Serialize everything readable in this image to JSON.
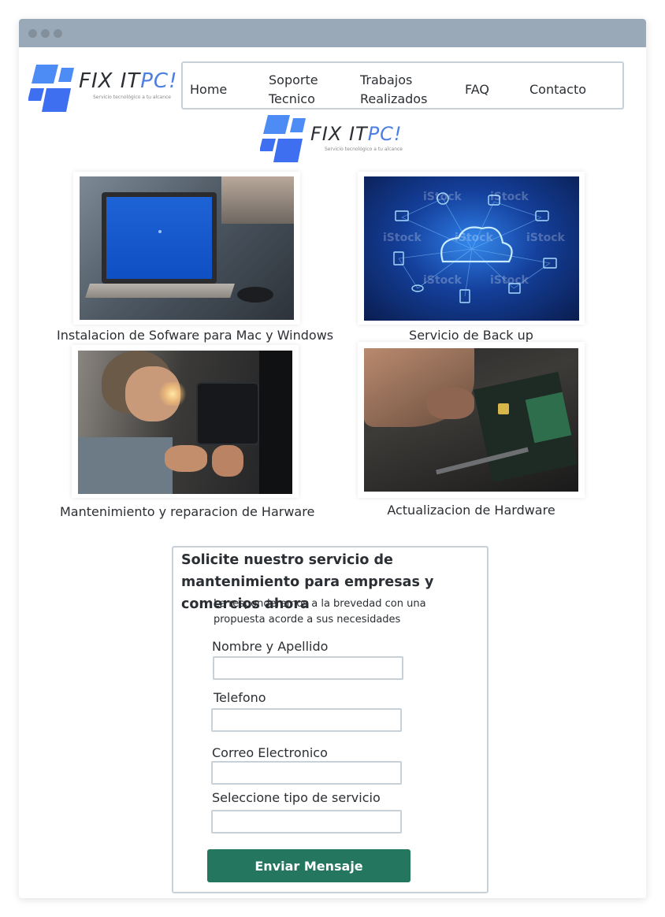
{
  "brand": {
    "name_main": "FIX IT",
    "name_accent": "PC!",
    "tagline": "Servicio tecnológico a tu alcance",
    "accent_color": "#4d7fe3",
    "mark_color": "#3d6ff0"
  },
  "nav": {
    "items": [
      {
        "label": "Home"
      },
      {
        "label": "Soporte\nTecnico"
      },
      {
        "label": "Trabajos\nRealizados"
      },
      {
        "label": "FAQ"
      },
      {
        "label": "Contacto"
      }
    ]
  },
  "services": [
    {
      "caption": "Instalacion de Sofware para Mac y Windows",
      "image": "laptop-blue-screen-photo"
    },
    {
      "caption": "Servicio de Back up",
      "image": "cloud-backup-illustration"
    },
    {
      "caption": "Mantenimiento y reparacion de Harware",
      "image": "technician-repairing-pc-photo"
    },
    {
      "caption": "Actualizacion de Hardware",
      "image": "hands-on-circuit-board-photo"
    }
  ],
  "stock_watermark": "iStock",
  "form": {
    "title": "Solicite nuestro servicio de mantenimiento para empresas y comercios ahora",
    "intro": "Le responderemos a la brevedad con una propuesta acorde a sus necesidades",
    "fields": [
      {
        "label": "Nombre y Apellido",
        "value": "",
        "placeholder": ""
      },
      {
        "label": "Telefono",
        "value": "",
        "placeholder": ""
      },
      {
        "label": "Correo Electronico",
        "value": "",
        "placeholder": ""
      },
      {
        "label": "Seleccione tipo de servicio",
        "value": "",
        "placeholder": ""
      }
    ],
    "submit_label": "Enviar Mensaje",
    "submit_color": "#24765f"
  }
}
